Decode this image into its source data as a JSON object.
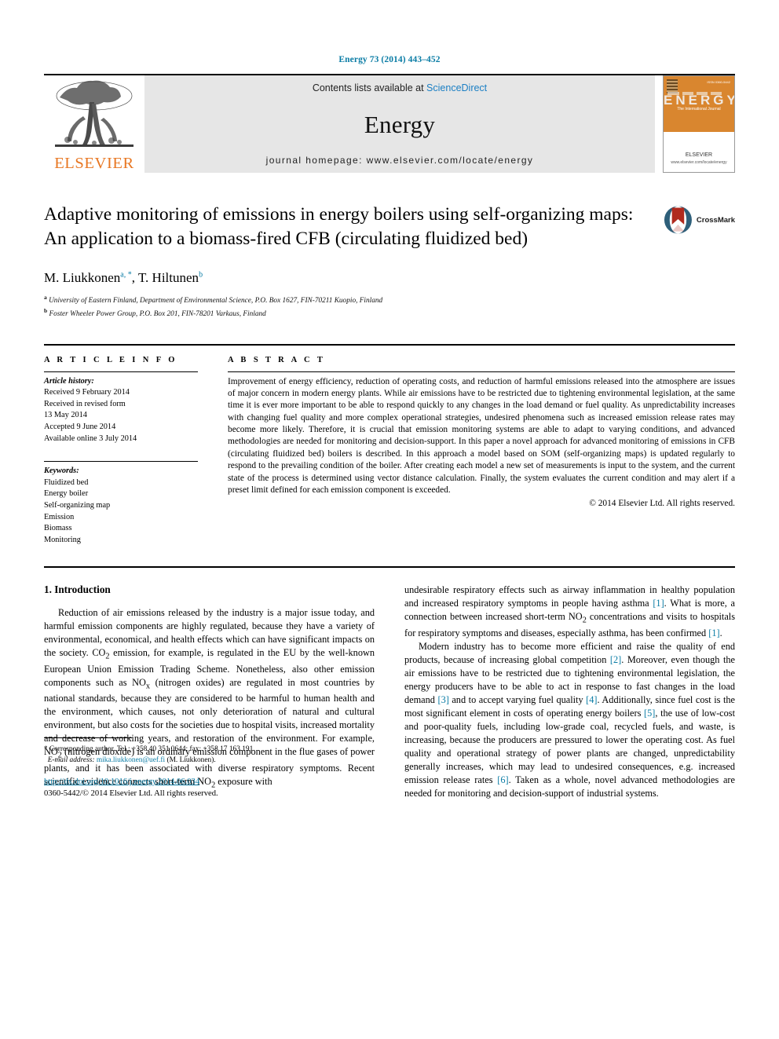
{
  "running_head": "Energy 73 (2014) 443–452",
  "banner": {
    "publisher_logo_text": "ELSEVIER",
    "contents_prefix": "Contents lists available at ",
    "contents_link": "ScienceDirect",
    "journal_name": "Energy",
    "homepage": "journal homepage: www.elsevier.com/locate/energy",
    "cover": {
      "title": "ENERGY",
      "caption": "The International Journal",
      "corner_label": "",
      "topright_label": "ISSN 0360-5442",
      "publisher": "ELSEVIER",
      "publisher_sub": "www.elsevier.com/locate/energy"
    }
  },
  "title_block": {
    "title": "Adaptive monitoring of emissions in energy boilers using self-organizing maps: An application to a biomass-fired CFB (circulating fluidized bed)",
    "crossmark_label": "CrossMark",
    "authors_1": "M. Liukkonen",
    "authors_1_sup": "a, *",
    "authors_sep": ", ",
    "authors_2": "T. Hiltunen",
    "authors_2_sup": "b",
    "affiliation_a_sup": "a",
    "affiliation_a": "University of Eastern Finland, Department of Environmental Science, P.O. Box 1627, FIN-70211 Kuopio, Finland",
    "affiliation_b_sup": "b",
    "affiliation_b": "Foster Wheeler Power Group, P.O. Box 201, FIN-78201 Varkaus, Finland"
  },
  "article_info": {
    "heading": "A R T I C L E   I N F O",
    "history_label": "Article history:",
    "history": [
      "Received 9 February 2014",
      "Received in revised form",
      "13 May 2014",
      "Accepted 9 June 2014",
      "Available online 3 July 2014"
    ],
    "keywords_label": "Keywords:",
    "keywords": [
      "Fluidized bed",
      "Energy boiler",
      "Self-organizing map",
      "Emission",
      "Biomass",
      "Monitoring"
    ]
  },
  "abstract": {
    "heading": "A B S T R A C T",
    "text": "Improvement of energy efficiency, reduction of operating costs, and reduction of harmful emissions released into the atmosphere are issues of major concern in modern energy plants. While air emissions have to be restricted due to tightening environmental legislation, at the same time it is ever more important to be able to respond quickly to any changes in the load demand or fuel quality. As unpredictability increases with changing fuel quality and more complex operational strategies, undesired phenomena such as increased emission release rates may become more likely. Therefore, it is crucial that emission monitoring systems are able to adapt to varying conditions, and advanced methodologies are needed for monitoring and decision-support. In this paper a novel approach for advanced monitoring of emissions in CFB (circulating fluidized bed) boilers is described. In this approach a model based on SOM (self-organizing maps) is updated regularly to respond to the prevailing condition of the boiler. After creating each model a new set of measurements is input to the system, and the current state of the process is determined using vector distance calculation. Finally, the system evaluates the current condition and may alert if a preset limit defined for each emission component is exceeded.",
    "copyright": "© 2014 Elsevier Ltd. All rights reserved."
  },
  "introduction": {
    "section_number_title": "1.  Introduction",
    "left_para_1_a": "Reduction of air emissions released by the industry is a major issue today, and harmful emission components are highly regulated, because they have a variety of environmental, economical, and health effects which can have significant impacts on the society. CO",
    "left_para_1_sub1": "2",
    "left_para_1_b": " emission, for example, is regulated in the EU by the well-known European Union Emission Trading Scheme. Nonetheless, also other emission components such as NO",
    "left_para_1_sub2": "x",
    "left_para_1_c": " (nitrogen oxides) are regulated in most countries by national standards, because they are considered to be harmful to human health and the environment, which causes, not only deterioration of natural and cultural environment, but also costs for the societies due to hospital visits, increased mortality and decrease of working years, and restoration of the environment. For example, NO",
    "left_para_1_sub3": "2",
    "left_para_1_d": " (nitrogen dioxide) is an ordinary emission component in the flue gases of power plants, and it has been associated with diverse respiratory symptoms. Recent scientific evidence connects short-term NO",
    "left_para_1_sub4": "2",
    "left_para_1_e": " exposure with",
    "right_para_1_a": "undesirable respiratory effects such as airway inflammation in healthy population and increased respiratory symptoms in people having asthma ",
    "right_ref_1": "[1]",
    "right_para_1_b": ". What is more, a connection between increased short-term NO",
    "right_para_1_sub1": "2",
    "right_para_1_c": " concentrations and visits to hospitals for respiratory symptoms and diseases, especially asthma, has been confirmed ",
    "right_ref_2": "[1]",
    "right_para_1_d": ".",
    "right_para_2_a": "Modern industry has to become more efficient and raise the quality of end products, because of increasing global competition ",
    "right_ref_3": "[2]",
    "right_para_2_b": ". Moreover, even though the air emissions have to be restricted due to tightening environmental legislation, the energy producers have to be able to act in response to fast changes in the load demand ",
    "right_ref_4": "[3]",
    "right_para_2_c": " and to accept varying fuel quality ",
    "right_ref_5": "[4]",
    "right_para_2_d": ". Additionally, since fuel cost is the most significant element in costs of operating energy boilers ",
    "right_ref_6": "[5]",
    "right_para_2_e": ", the use of low-cost and poor-quality fuels, including low-grade coal, recycled fuels, and waste, is increasing, because the producers are pressured to lower the operating cost. As fuel quality and operational strategy of power plants are changed, unpredictability generally increases, which may lead to undesired consequences, e.g. increased emission release rates ",
    "right_ref_7": "[6]",
    "right_para_2_f": ". Taken as a whole, novel advanced methodologies are needed for monitoring and decision-support of industrial systems."
  },
  "footnote": {
    "star": "*",
    "corresponding": "Corresponding author. Tel.: +358 40 351 0644; fax: +358 17 163 191.",
    "email_label": "E-mail address:",
    "email": "mika.liukkonen@uef.fi",
    "email_suffix": "(M. Liukkonen).",
    "doi": "http://dx.doi.org/10.1016/j.energy.2014.06.034",
    "issn": "0360-5442/© 2014 Elsevier Ltd. All rights reserved."
  },
  "colors": {
    "link": "#0a7ca5",
    "sciencedirect": "#1b7fc4",
    "elsevier_orange": "#E87722",
    "crossmark_red": "#b02a1e",
    "cover_orange": "#d9862f"
  }
}
